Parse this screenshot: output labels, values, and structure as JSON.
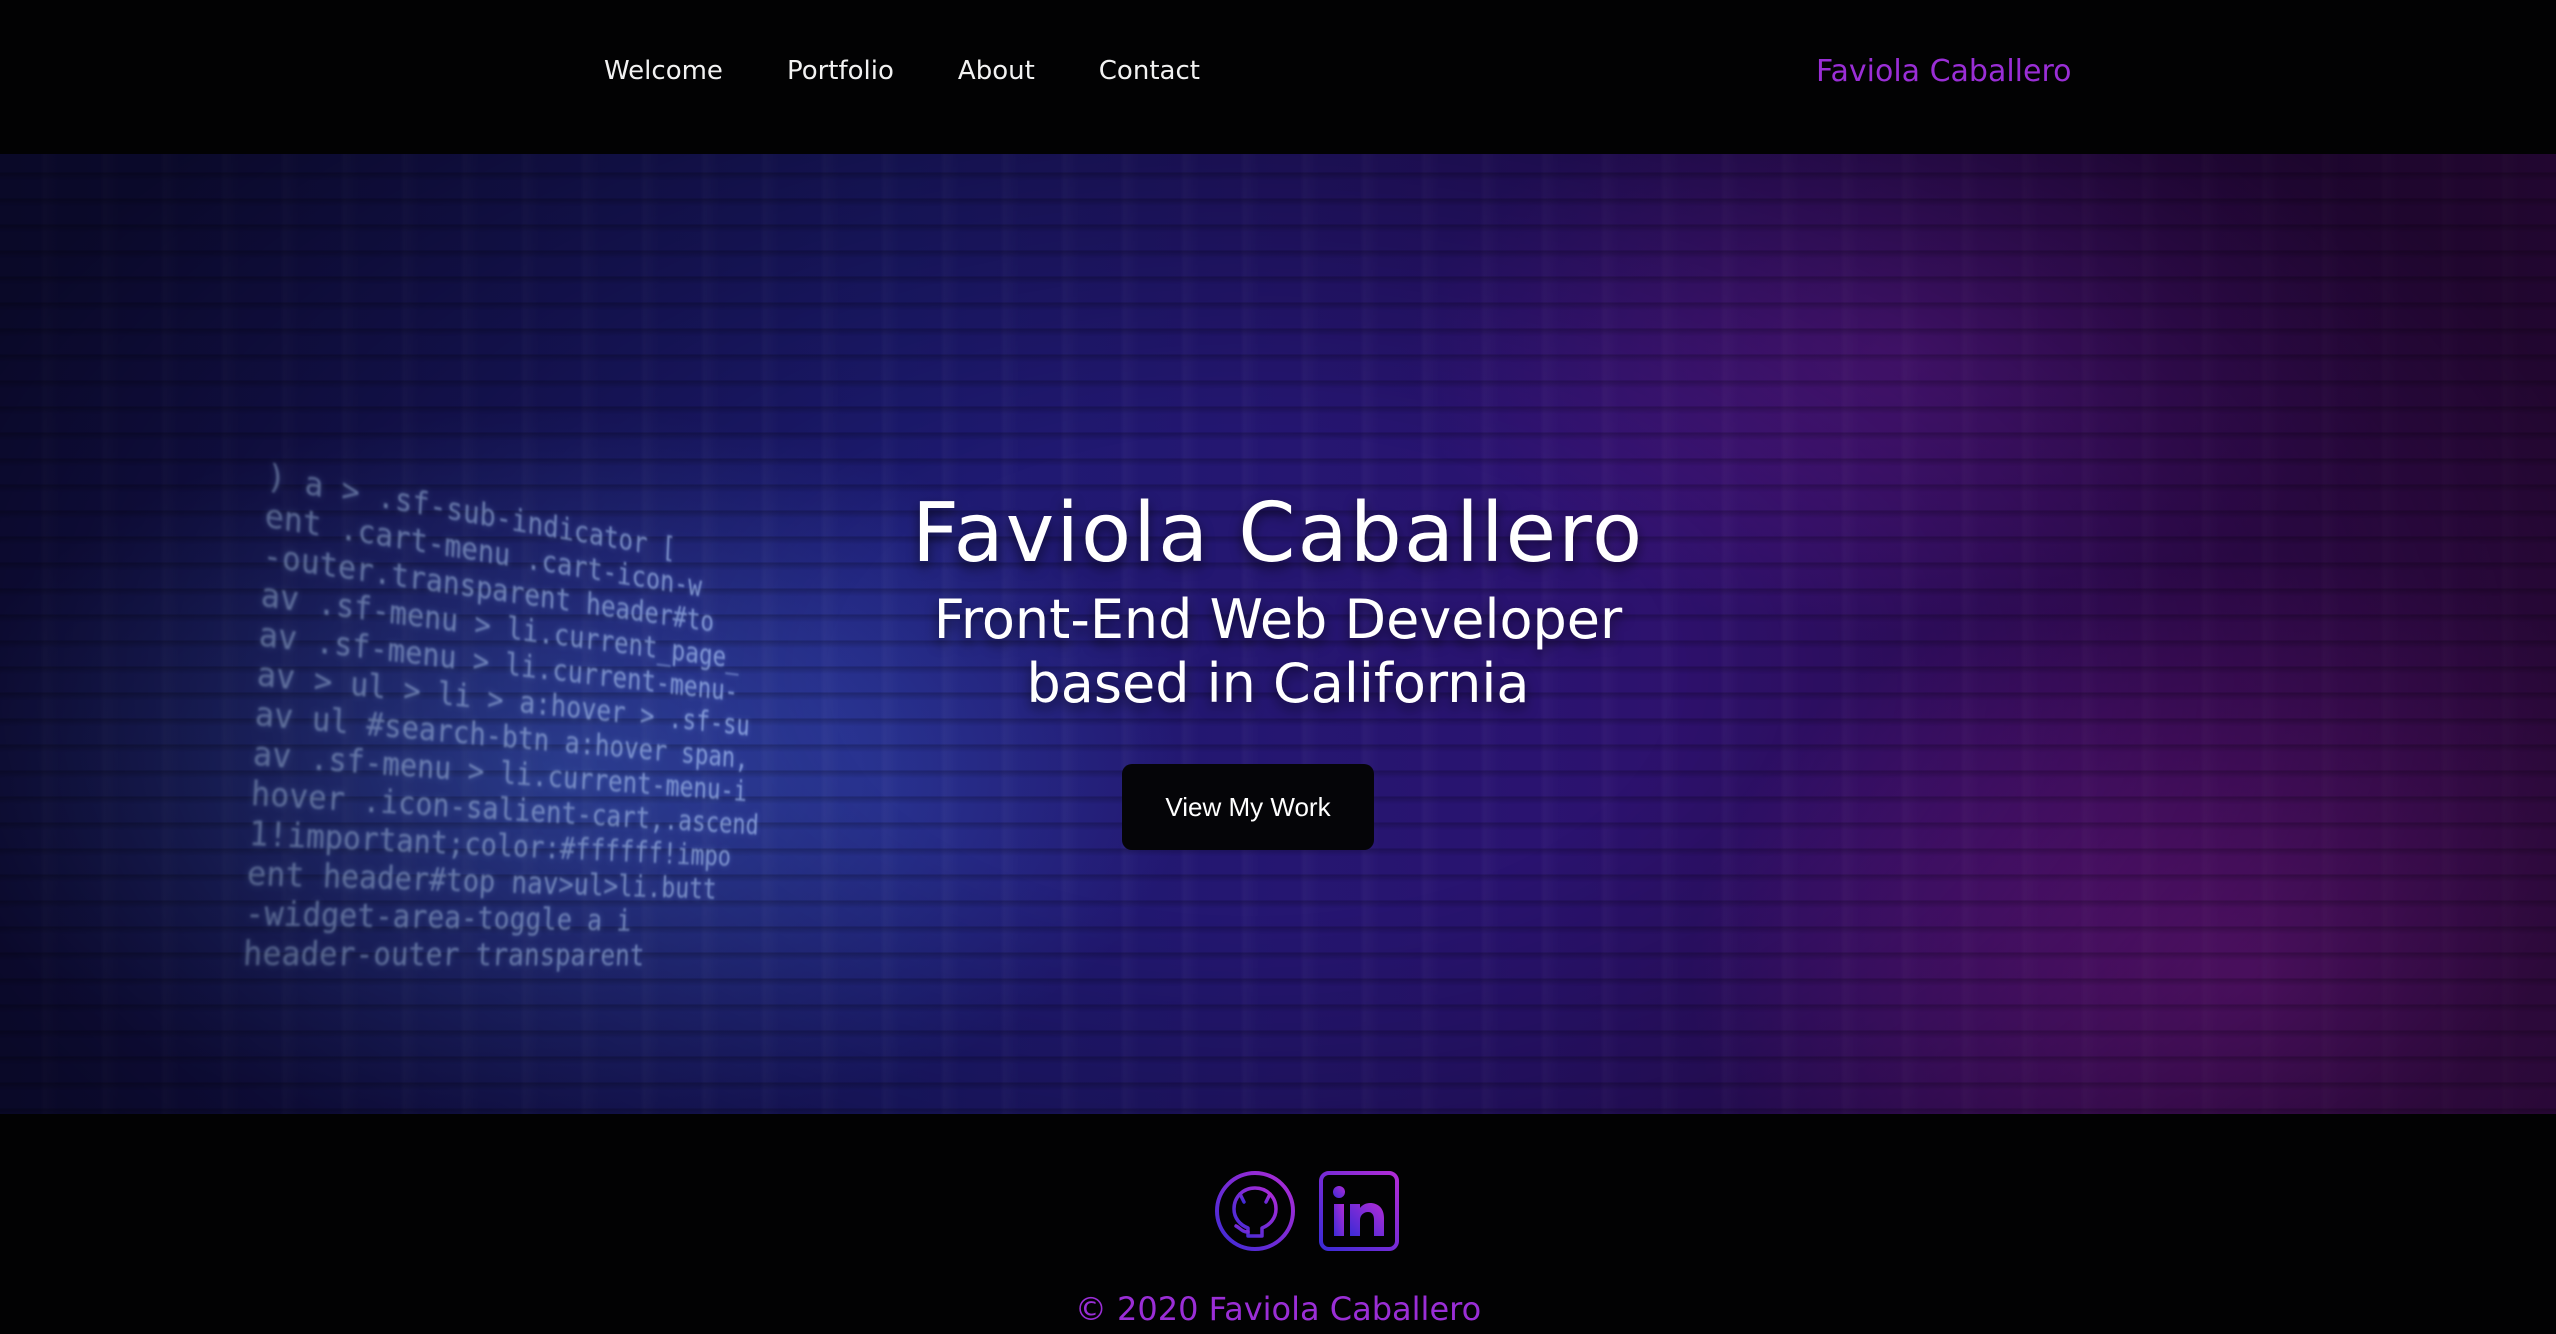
{
  "nav": {
    "links": [
      {
        "label": "Welcome"
      },
      {
        "label": "Portfolio"
      },
      {
        "label": "About"
      },
      {
        "label": "Contact"
      }
    ],
    "brand": "Faviola Caballero"
  },
  "hero": {
    "title": "Faviola Caballero",
    "subtitle_line1": "Front-End Web Developer",
    "subtitle_line2": "based in California",
    "button_label": "View My Work",
    "code_lines": [
      ") a > .sf-sub-indicator [",
      "ent .cart-menu .cart-icon-w",
      "-outer.transparent header#to",
      "av .sf-menu > li.current_page_",
      "av .sf-menu > li.current-menu-",
      "av > ul > li > a:hover > .sf-su",
      "av ul #search-btn a:hover span,",
      "av .sf-menu > li.current-menu-i",
      "hover .icon-salient-cart,.ascend",
      "1!important;color:#ffffff!impo",
      "ent header#top nav>ul>li.butt",
      "-widget-area-toggle a i",
      "header-outer transparent"
    ]
  },
  "footer": {
    "social": [
      {
        "icon": "github-icon"
      },
      {
        "icon": "linkedin-icon"
      }
    ],
    "copyright": "© 2020 Faviola Caballero"
  },
  "colors": {
    "accent": "#9a2ed6",
    "background": "#020203",
    "icon_gradient_start": "#3b2bd6",
    "icon_gradient_end": "#b22bd6"
  }
}
